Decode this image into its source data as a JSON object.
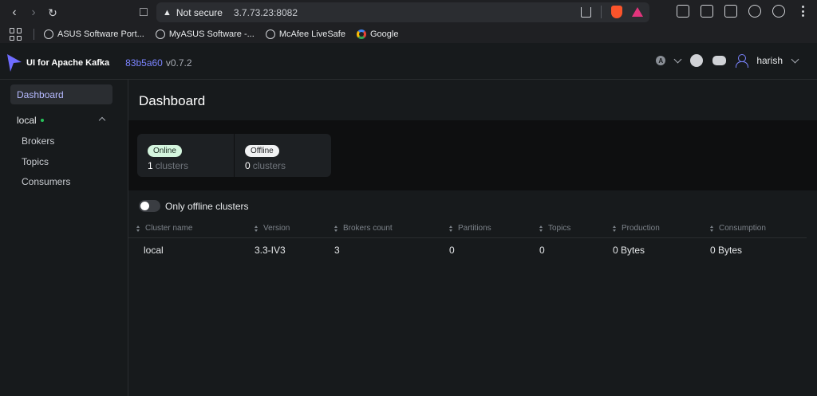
{
  "browser": {
    "not_secure_label": "Not secure",
    "url": "3.7.73.23:8082",
    "bookmarks": [
      {
        "label": "ASUS Software Port...",
        "icon": "globe-icon"
      },
      {
        "label": "MyASUS Software -...",
        "icon": "globe-icon"
      },
      {
        "label": "McAfee LiveSafe",
        "icon": "globe-icon"
      },
      {
        "label": "Google",
        "icon": "google-icon"
      }
    ]
  },
  "header": {
    "logo_text": "UI for Apache Kafka",
    "version_hash": "83b5a60",
    "version": "v0.7.2",
    "user": "harish"
  },
  "sidebar": {
    "dashboard_label": "Dashboard",
    "cluster_name": "local",
    "cluster_items": [
      "Brokers",
      "Topics",
      "Consumers"
    ]
  },
  "main": {
    "title": "Dashboard",
    "online": {
      "badge": "Online",
      "count": "1",
      "unit": "clusters"
    },
    "offline": {
      "badge": "Offline",
      "count": "0",
      "unit": "clusters"
    },
    "toggle_label": "Only offline clusters",
    "columns": [
      "Cluster name",
      "Version",
      "Brokers count",
      "Partitions",
      "Topics",
      "Production",
      "Consumption"
    ],
    "rows": [
      [
        "local",
        "3.3-IV3",
        "3",
        "0",
        "0",
        "0 Bytes",
        "0 Bytes"
      ]
    ]
  },
  "colors": {
    "accent": "#7b84ff",
    "online_dot": "#27c25a",
    "background": "#171a1c"
  }
}
